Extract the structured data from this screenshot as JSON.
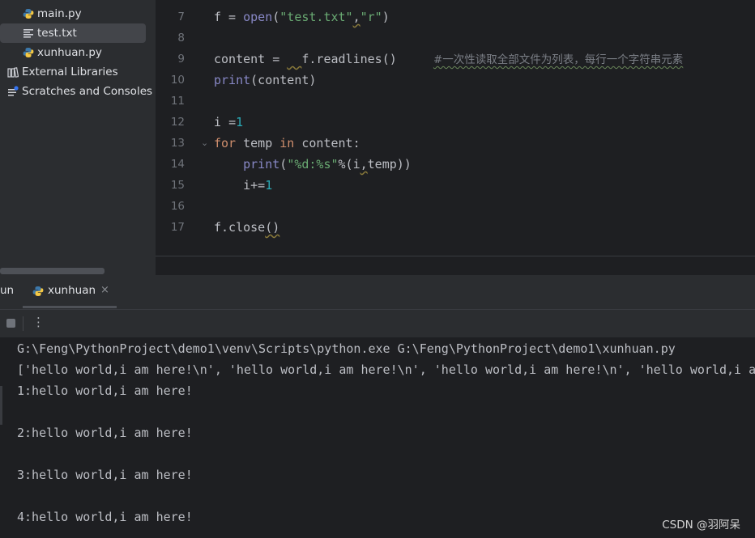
{
  "project_tree": {
    "items": [
      {
        "label": "main.py",
        "icon": "python-file-icon"
      },
      {
        "label": "test.txt",
        "icon": "text-file-icon",
        "selected": true
      },
      {
        "label": "xunhuan.py",
        "icon": "python-file-icon"
      },
      {
        "label": "External Libraries",
        "icon": "library-icon"
      },
      {
        "label": "Scratches and Consoles",
        "icon": "scratches-icon"
      }
    ]
  },
  "editor": {
    "line_numbers": [
      "7",
      "8",
      "9",
      "10",
      "11",
      "12",
      "13",
      "14",
      "15",
      "16",
      "17"
    ],
    "lines": {
      "l7": {
        "v": "f",
        "eq": " = ",
        "open": "open",
        "p1": "(",
        "s1": "\"test.txt\"",
        "comma": ",",
        "s2": "\"r\"",
        "p2": ")"
      },
      "l9": {
        "v": "content",
        "eq": " = ",
        "sp": "  ",
        "call": "f.readlines()",
        "gap": "     ",
        "comment": "#一次性读取全部文件为列表，每行一个字符串元素"
      },
      "l10": {
        "fn": "print",
        "arg": "(content)"
      },
      "l12": {
        "v": "i ",
        "eq": "=",
        "n": "1"
      },
      "l13": {
        "kw1": "for",
        "v": " temp ",
        "kw2": "in",
        "rest": " content:"
      },
      "l14": {
        "indent": "    ",
        "fn": "print",
        "p1": "(",
        "s": "\"%d:%s\"",
        "rest1": "%(i",
        "comma": ",",
        "rest2": "temp))"
      },
      "l15": {
        "indent": "    ",
        "v": "i+=",
        "n": "1"
      },
      "l17": {
        "call": "f.close",
        "paren": "()"
      }
    }
  },
  "run_panel": {
    "cut_label": "un",
    "tab_label": "xunhuan",
    "close_glyph": "×",
    "more_glyph": "⋮"
  },
  "console": {
    "lines": [
      "G:\\Feng\\PythonProject\\demo1\\venv\\Scripts\\python.exe G:\\Feng\\PythonProject\\demo1\\xunhuan.py",
      "['hello world,i am here!\\n', 'hello world,i am here!\\n', 'hello world,i am here!\\n', 'hello world,i am",
      "1:hello world,i am here!",
      "",
      "2:hello world,i am here!",
      "",
      "3:hello world,i am here!",
      "",
      "4:hello world,i am here!"
    ]
  },
  "watermark": "CSDN @羽阿呆",
  "colors": {
    "background": "#1e1f22",
    "panel": "#2b2d30",
    "keyword": "#cf8e6d",
    "string": "#6aab73",
    "number": "#2aacb8",
    "builtin": "#8888c6"
  }
}
